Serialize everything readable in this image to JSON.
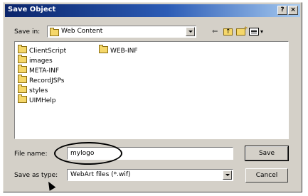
{
  "window": {
    "title": "Save Object",
    "help_label": "?",
    "close_label": "×"
  },
  "lookin": {
    "label": "Save in:",
    "value": "Web Content"
  },
  "toolbar": {
    "back_label": "⇐",
    "views_arrow_label": "▾"
  },
  "files": [
    "ClientScript",
    "images",
    "META-INF",
    "RecordJSPs",
    "styles",
    "UIMHelp",
    "WEB-INF"
  ],
  "filename": {
    "label": "File name:",
    "value": "mylogo"
  },
  "savetype": {
    "label": "Save as type:",
    "value": "WebArt files (*.wif)"
  },
  "buttons": {
    "save": "Save",
    "cancel": "Cancel"
  }
}
